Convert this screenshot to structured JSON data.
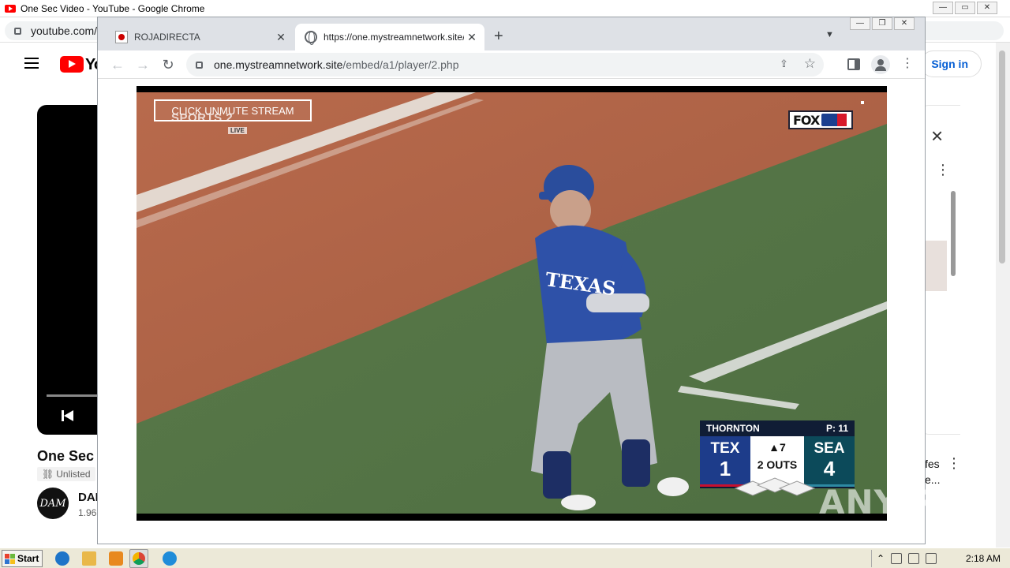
{
  "background_window": {
    "title": "One Sec Video - YouTube - Google Chrome",
    "url": "youtube.com/",
    "youtube": {
      "logo_text": "Yo",
      "video_title": "One Sec",
      "unlisted_label": "Unlisted",
      "avatar_text": "DAM",
      "channel_name": "DAI",
      "subs_text": "1.96",
      "signin_label": "Sign in",
      "side_text_line1": "fes",
      "side_text_line2": "e..."
    }
  },
  "foreground_window": {
    "tabs": [
      {
        "label": "ROJADIRECTA",
        "active": false
      },
      {
        "label": "https://one.mystreamnetwork.site/em",
        "active": true
      }
    ],
    "new_tab": "+",
    "address": {
      "host": "one.mystreamnetwork.site",
      "path": "/embed/a1/player/2.php"
    }
  },
  "video": {
    "unmute_label": "CLICK UNMUTE STREAM",
    "network_logo": "SPORTS 2",
    "network_live": "LIVE",
    "broadcaster": "FOX",
    "scorebug": {
      "pitcher": "THORNTON",
      "pitch_count": "P: 11",
      "away_abbr": "TEX",
      "away_score": "1",
      "inning": "▲7",
      "outs": "2 OUTS",
      "home_abbr": "SEA",
      "home_score": "4"
    },
    "watermark": "ANY RUN"
  },
  "taskbar": {
    "start_label": "Start",
    "clock": "2:18 AM"
  },
  "colors": {
    "tex_blue": "#1d3c8a",
    "sea_teal": "#0c4a5a",
    "youtube_red": "#ff0000",
    "signin_blue": "#065fd4"
  }
}
